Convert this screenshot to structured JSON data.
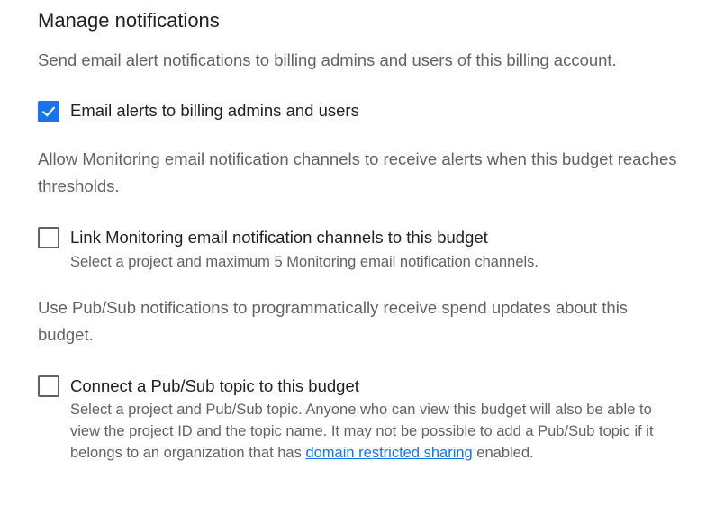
{
  "section": {
    "title": "Manage notifications"
  },
  "billing_alerts": {
    "description": "Send email alert notifications to billing admins and users of this billing account.",
    "checkbox_label": "Email alerts to billing admins and users",
    "checked": true
  },
  "monitoring": {
    "description": "Allow Monitoring email notification channels to receive alerts when this budget reaches thresholds.",
    "checkbox_label": "Link Monitoring email notification channels to this budget",
    "hint": "Select a project and maximum 5 Monitoring email notification channels.",
    "checked": false
  },
  "pubsub": {
    "description": "Use Pub/Sub notifications to programmatically receive spend updates about this budget.",
    "checkbox_label": "Connect a Pub/Sub topic to this budget",
    "hint_before_link": "Select a project and Pub/Sub topic. Anyone who can view this budget will also be able to view the project ID and the topic name. It may not be possible to add a Pub/Sub topic if it belongs to an organization that has ",
    "hint_link": "domain restricted sharing",
    "hint_after_link": " enabled.",
    "checked": false
  },
  "colors": {
    "accent": "#1a73e8",
    "text_primary": "#202124",
    "text_secondary": "#5f6368"
  }
}
